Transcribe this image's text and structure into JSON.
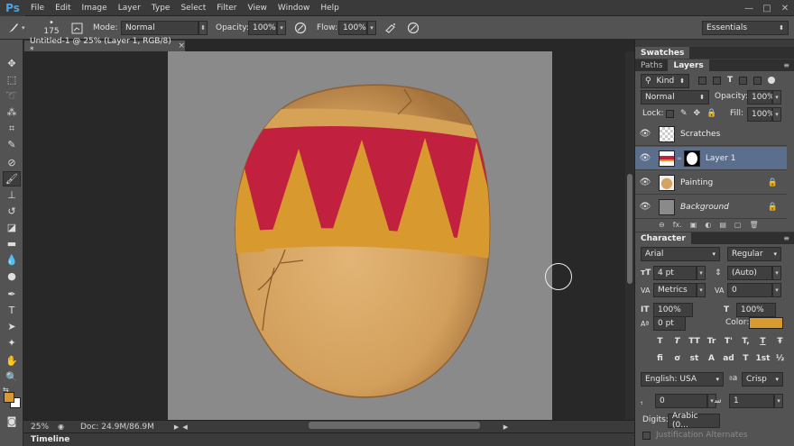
{
  "menubar": {
    "logo": "Ps",
    "items": [
      "File",
      "Edit",
      "Image",
      "Layer",
      "Type",
      "Select",
      "Filter",
      "View",
      "Window",
      "Help"
    ],
    "window_controls": [
      "—",
      "□",
      "✕"
    ]
  },
  "options": {
    "brush_size": "175",
    "mode_label": "Mode:",
    "mode_value": "Normal",
    "opacity_label": "Opacity:",
    "opacity_value": "100%",
    "flow_label": "Flow:",
    "flow_value": "100%",
    "workspace": "Essentials"
  },
  "document": {
    "tab_title": "Untitled-1 @ 25% (Layer 1, RGB/8) *",
    "tab_close": "×",
    "zoom": "25%",
    "doc_info": "Doc: 24.9M/86.9M",
    "timeline_label": "Timeline"
  },
  "panels": {
    "swatches_tab": "Swatches",
    "paths_tab": "Paths",
    "layers_tab": "Layers",
    "kind_value": "Kind",
    "blend_mode": "Normal",
    "opacity_label": "Opacity:",
    "opacity_value": "100%",
    "lock_label": "Lock:",
    "fill_label": "Fill:",
    "fill_value": "100%",
    "layers": [
      {
        "name": "Scratches",
        "selected": false,
        "locked": false
      },
      {
        "name": "Layer 1",
        "selected": true,
        "locked": false
      },
      {
        "name": "Painting",
        "selected": false,
        "locked": true
      },
      {
        "name": "Background",
        "selected": false,
        "locked": true
      }
    ],
    "layer_footer_icons": [
      "⊖",
      "fx.",
      "▣",
      "◐",
      "▤",
      "▢",
      "🗑"
    ]
  },
  "character": {
    "tab": "Character",
    "font_family": "Arial",
    "font_style": "Regular",
    "font_size": "4 pt",
    "leading": "(Auto)",
    "kerning": "Metrics",
    "tracking": "0",
    "vscale": "100%",
    "hscale": "100%",
    "baseline": "0 pt",
    "color_label": "Color:",
    "color_value": "#d89a2e",
    "style_glyphs_1": [
      "T",
      "T",
      "TT",
      "Tr",
      "T'",
      "T,",
      "T",
      "Ŧ"
    ],
    "style_glyphs_2": [
      "fi",
      "ơ",
      "st",
      "A",
      "ad",
      "T",
      "1st",
      "½"
    ],
    "language": "English: USA",
    "aa_label": "a",
    "aa_value": "Crisp",
    "field_a": "0",
    "field_b": "1",
    "digits_label": "Digits:",
    "digits_value": "Arabic (0...",
    "justification": "Justification Alternates"
  },
  "colors": {
    "foreground": "#d89a2e",
    "background": "#ffffff",
    "egg_light": "#d5a461",
    "egg_dark": "#a8773f",
    "band_red": "#c2203f",
    "band_yellow": "#d7982f"
  }
}
